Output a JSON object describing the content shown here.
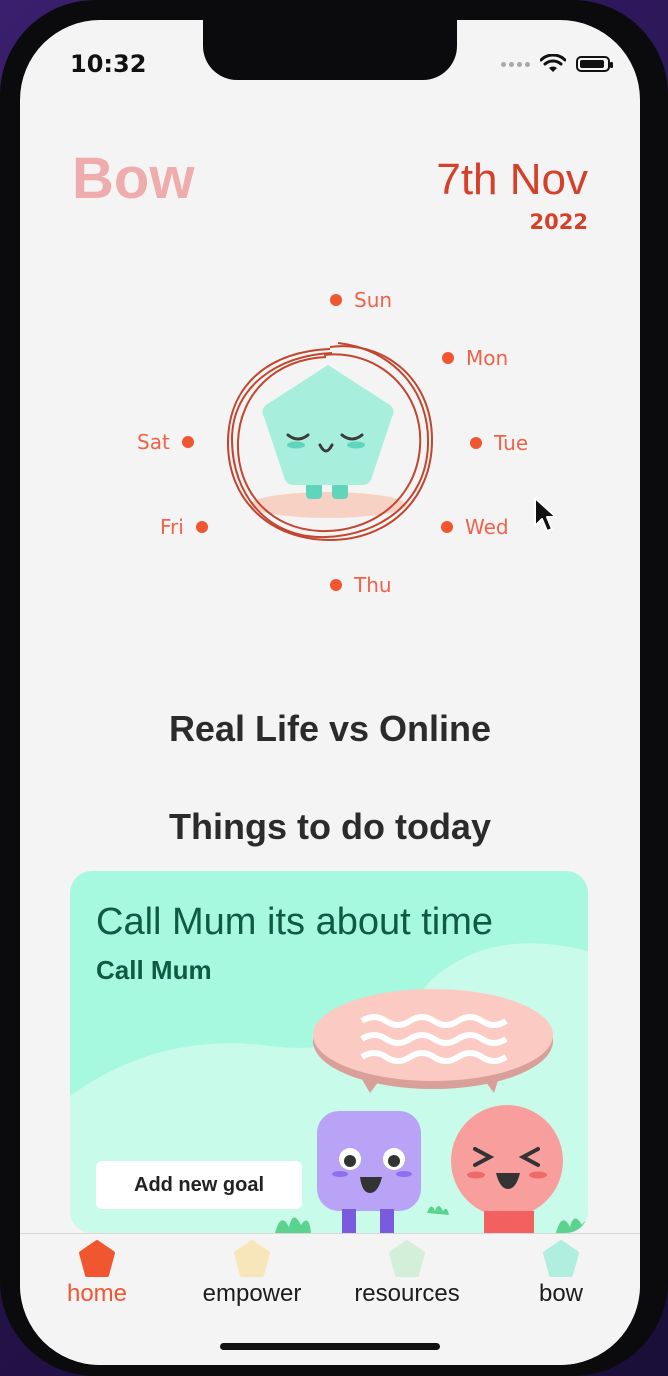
{
  "status_bar": {
    "time": "10:32"
  },
  "header": {
    "title": "Bow",
    "date": "7th Nov",
    "year": "2022"
  },
  "week_days": [
    "Sun",
    "Mon",
    "Tue",
    "Wed",
    "Thu",
    "Fri",
    "Sat"
  ],
  "sections": {
    "real_life_title": "Real Life vs Online",
    "things_title": "Things to do today"
  },
  "todo_card": {
    "heading": "Call Mum its about time",
    "subtitle": "Call Mum",
    "button_label": "Add new goal"
  },
  "tabs": [
    {
      "label": "home",
      "icon": "home-icon",
      "color": "#f0562f",
      "active": true
    },
    {
      "label": "empower",
      "icon": "empower-icon",
      "color": "#f7e6b9",
      "active": false
    },
    {
      "label": "resources",
      "icon": "resources-icon",
      "color": "#d4efd9",
      "active": false
    },
    {
      "label": "bow",
      "icon": "bow-icon",
      "color": "#b0eee0",
      "active": false
    }
  ],
  "colors": {
    "accent": "#f0562f",
    "title_pink": "#efacad",
    "date_red": "#d5402a",
    "card_mint": "#a6f8de",
    "mascot_teal": "#a8eedd"
  }
}
